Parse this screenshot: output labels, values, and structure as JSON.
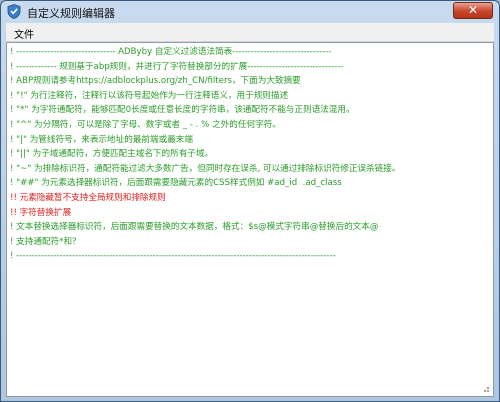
{
  "window": {
    "title": "自定义规则编辑器",
    "close_glyph": "✕",
    "icon": "shield-icon"
  },
  "menu": {
    "file_label": "文件"
  },
  "editor": {
    "lines": [
      {
        "text": "! -------------------------------- ADByby 自定义过滤语法简表--------------------------------",
        "color": "green"
      },
      {
        "text": "! ------------- 规则基于abp规则，并进行了字符替换部分的扩展-------------------------------",
        "color": "green"
      },
      {
        "text": "! ABP规则请参考https://adblockplus.org/zh_CN/filters，下面为大致摘要",
        "color": "green"
      },
      {
        "text": "! \"!\" 为行注释符，注释行以该符号起始作为一行注释语义，用于规则描述",
        "color": "green"
      },
      {
        "text": "! \"*\" 为字符通配符，能够匹配0长度或任意长度的字符串，该通配符不能与正则语法混用。",
        "color": "green"
      },
      {
        "text": "! \"^\" 为分隔符，可以是除了字母、数字或者 _ - . % 之外的任何字符。",
        "color": "green"
      },
      {
        "text": "! \"|\" 为管线符号，来表示地址的最前端或最末端",
        "color": "green"
      },
      {
        "text": "! \"||\" 为子域通配符，方便匹配主域名下的所有子域。",
        "color": "green"
      },
      {
        "text": "! \"~\" 为排除标识符，通配符能过滤大多数广告，但同时存在误杀, 可以通过排除标识符修正误杀链接。",
        "color": "green"
      },
      {
        "text": "! \"##\" 为元素选择器标识符，后面跟需要隐藏元素的CSS样式例如 #ad_id  .ad_class",
        "color": "green"
      },
      {
        "text": "!! 元素隐藏暂不支持全局规则和排除规则",
        "color": "red"
      },
      {
        "text": "!! 字符替换扩展",
        "color": "red"
      },
      {
        "text": "! 文本替换选择器标识符，后面跟需要替换的文本数据，格式：$s@模式字符串@替换后的文本@",
        "color": "green"
      },
      {
        "text": "! 支持通配符*和？",
        "color": "green"
      },
      {
        "text": "! -------------------------------------------------------------------------------------------------------",
        "color": "green"
      }
    ]
  }
}
